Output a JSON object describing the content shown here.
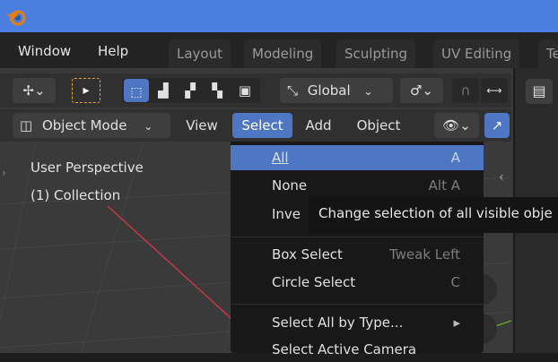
{
  "menubar": {
    "window": "Window",
    "help": "Help"
  },
  "workspace_tabs": [
    "Layout",
    "Modeling",
    "Sculpting",
    "UV Editing",
    "Te"
  ],
  "header": {
    "orientation": "Global",
    "mode": "Object Mode",
    "view": "View",
    "select": "Select",
    "add": "Add",
    "object": "Object"
  },
  "viewport": {
    "perspective": "User Perspective",
    "collection": "(1) Collection"
  },
  "select_menu": {
    "items": [
      {
        "label": "All",
        "shortcut": "A"
      },
      {
        "label": "None",
        "shortcut": "Alt A"
      },
      {
        "label": "Inve",
        "shortcut": ""
      },
      {
        "label": "Box Select",
        "shortcut": "Tweak Left"
      },
      {
        "label": "Circle Select",
        "shortcut": "C"
      },
      {
        "label": "Select All by Type...",
        "shortcut": ""
      },
      {
        "label": "Select Active Camera",
        "shortcut": ""
      }
    ]
  },
  "tooltip": {
    "text": "Change selection of all visible obje"
  },
  "colors": {
    "accent": "#4f76c2",
    "titlebar": "#4a7fe0",
    "logo": "#e87d0d",
    "axis_x": "#c23a4a"
  },
  "icons": [
    "blender-logo-icon",
    "cursor-transform-icon",
    "select-tool-icon",
    "select-box-mode-icons",
    "transform-orientation-icon",
    "pivot-icon",
    "snap-icon",
    "proportional-icon",
    "editor-type-icon",
    "object-mode-icon",
    "viewport-gizmo-icon",
    "transform-gizmo-icon",
    "submenu-arrow-icon"
  ]
}
